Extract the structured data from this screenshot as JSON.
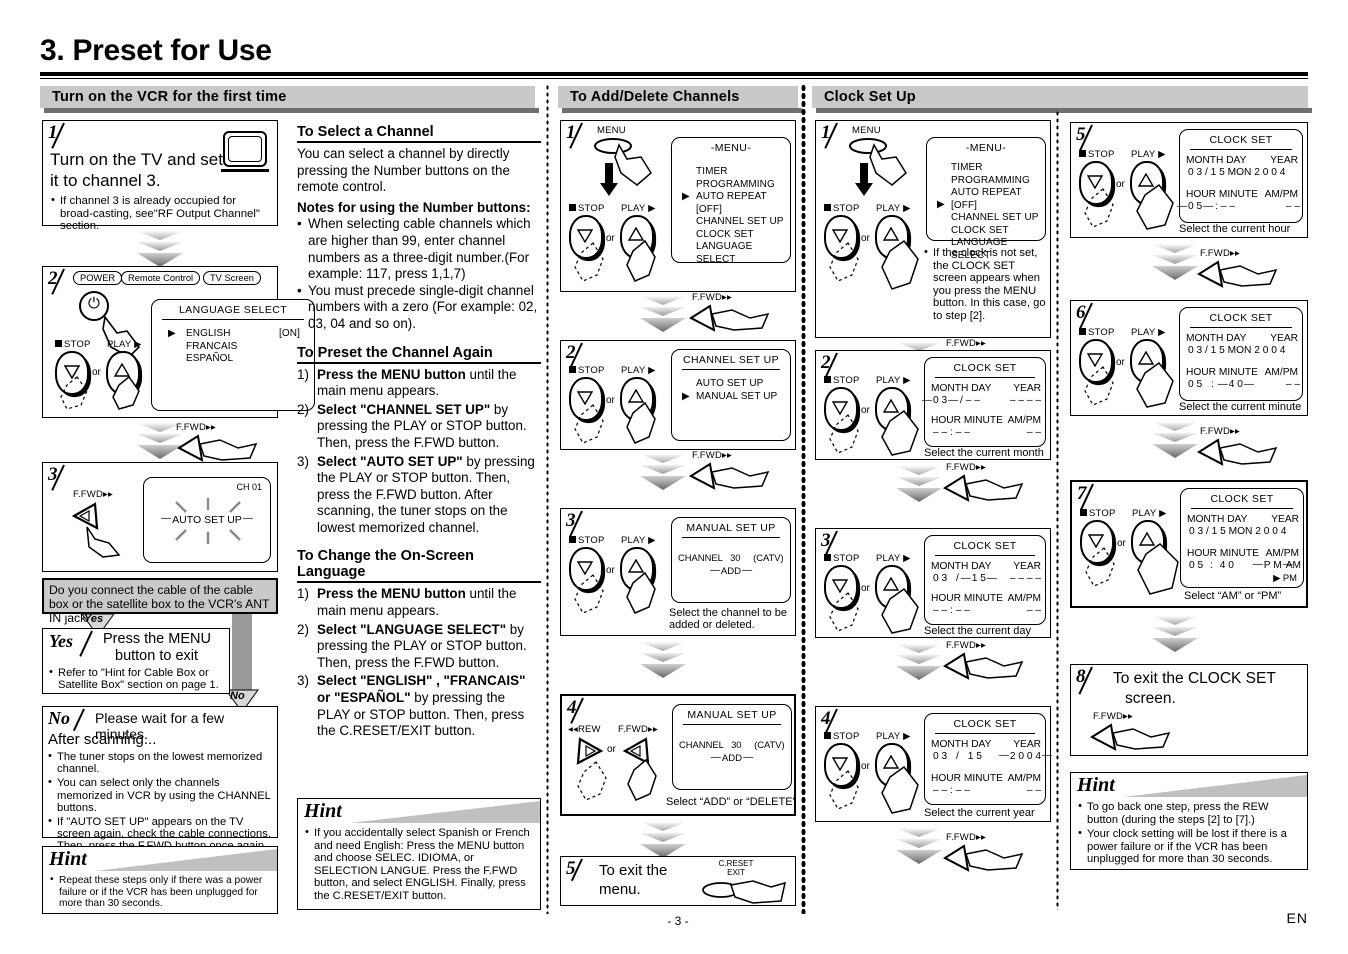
{
  "page": {
    "title": "3. Preset for Use",
    "footer_page": "- 3 -",
    "footer_lang": "EN"
  },
  "sections": {
    "col1_header": "Turn on the VCR for the first time",
    "col3_header": "To Add/Delete Channels",
    "col4_header": "Clock Set Up"
  },
  "col1": {
    "step1": {
      "num": "1",
      "line1": "Turn on the TV and set",
      "line2": "it to channel 3.",
      "note": "If channel 3 is already occupied for broad-casting, see\"RF Output Channel\" section."
    },
    "step2": {
      "num": "2",
      "power_label": "POWER",
      "bubble_remote": "Remote Control",
      "bubble_tv": "TV Screen",
      "stop_label": "STOP",
      "play_label": "PLAY",
      "or_label": "or",
      "osd_title": "LANGUAGE SELECT",
      "osd_items": [
        "ENGLISH",
        "FRANCAIS",
        "ESPAÑOL"
      ],
      "osd_on": "[ON]",
      "cursor": "▶"
    },
    "ffwd_label": "F.FWD",
    "step3": {
      "num": "3",
      "ffwd_label": "F.FWD",
      "ch_label": "CH 01",
      "osd_text": "AUTO SET UP"
    },
    "question": "Do you connect the cable of the cable box or the satellite box to the VCR's ANT IN jack?",
    "yes_tag": "Yes",
    "no_tag": "No",
    "yes_box": {
      "label": "Yes",
      "line1": "Press the MENU",
      "line2": "button to exit",
      "note": "Refer to \"Hint for Cable Box or Satellite Box\" section on page 1."
    },
    "no_box": {
      "label": "No",
      "lead": "Please wait for a few minutes.",
      "subhead": "After scanning...",
      "bullets": [
        "The tuner stops on the lowest memorized channel.",
        "You can select only the channels memorized in VCR by using the CHANNEL buttons.",
        "If \"AUTO SET UP\" appears on the TV screen again, check the cable connections. Then, press the F.FWD button once again."
      ]
    },
    "hint": {
      "title": "Hint",
      "bullets": [
        "Repeat these steps only if there was a power failure or if the VCR has been unplugged for more than 30 seconds."
      ]
    }
  },
  "col2": {
    "select_channel": {
      "heading": "To Select a Channel",
      "para": "You can select a channel by directly pressing the Number buttons on the remote control.",
      "notes_heading": "Notes for using the Number buttons:",
      "bullets": [
        "When selecting cable channels which are higher than 99, enter channel numbers as a three-digit number.(For example: 117, press 1,1,7)",
        "You must precede single-digit channel numbers with a zero (For example: 02, 03, 04 and so on)."
      ]
    },
    "preset_again": {
      "heading": "To Preset the Channel Again",
      "steps": [
        {
          "n": "1)",
          "bold": "Press the MENU button",
          "rest": " until the main menu appears."
        },
        {
          "n": "2)",
          "bold": "Select \"CHANNEL SET UP\"",
          "rest": " by pressing the PLAY or STOP button. Then, press the F.FWD button."
        },
        {
          "n": "3)",
          "bold": "Select \"AUTO SET UP\"",
          "rest": " by pressing  the PLAY or STOP button. Then, press the F.FWD button. After scanning, the tuner stops on the lowest memorized channel."
        }
      ]
    },
    "change_language": {
      "heading": "To Change the On-Screen Language",
      "steps": [
        {
          "n": "1)",
          "bold": "Press the MENU button",
          "rest": " until the main menu appears."
        },
        {
          "n": "2)",
          "bold": "Select \"LANGUAGE SELECT\"",
          "rest": " by pressing the PLAY or STOP button. Then, press the F.FWD button."
        },
        {
          "n": "3)",
          "bold": "Select \"ENGLISH\" , \"FRANCAIS\" or \"ESPAÑOL\"",
          "rest": " by pressing the PLAY or STOP button. Then, press the C.RESET/EXIT button."
        }
      ]
    },
    "hint": {
      "title": "Hint",
      "bullets": [
        "If you accidentally select Spanish or French and need English: Press the MENU button and choose SELEC. IDIOMA, or SELECTION LANGUE.  Press the F.FWD button, and select ENGLISH. Finally, press the C.RESET/EXIT button."
      ]
    }
  },
  "col3": {
    "step1": {
      "num": "1",
      "menu_label": "MENU",
      "stop_label": "STOP",
      "play_label": "PLAY",
      "or_label": "or",
      "osd_title": "-MENU-",
      "osd_items": [
        "TIMER PROGRAMMING",
        "AUTO REPEAT  [OFF]",
        "CHANNEL SET UP",
        "CLOCK SET",
        "LANGUAGE SELECT"
      ],
      "cursor_index": 2
    },
    "step2": {
      "num": "2",
      "stop_label": "STOP",
      "play_label": "PLAY",
      "or_label": "or",
      "osd_title": "CHANNEL SET UP",
      "osd_items": [
        "AUTO SET UP",
        "MANUAL SET UP"
      ],
      "cursor_index": 1
    },
    "step3": {
      "num": "3",
      "stop_label": "STOP",
      "play_label": "PLAY",
      "or_label": "or",
      "osd_title": "MANUAL SET UP",
      "channel_label": "CHANNEL",
      "channel_value": "30",
      "catv": "(CATV)",
      "addel": "ADD",
      "caption": "Select the channel to be added or deleted."
    },
    "step4": {
      "num": "4",
      "rew_label": "REW",
      "ffwd_label": "F.FWD",
      "or_label": "or",
      "osd_title": "MANUAL SET UP",
      "channel_label": "CHANNEL",
      "channel_value": "30",
      "catv": "(CATV)",
      "addel": "ADD",
      "caption": "Select “ADD” or “DELETE”"
    },
    "step5": {
      "num": "5",
      "line1": "To exit the",
      "line2": "menu.",
      "btn_label1": "C.RESET",
      "btn_label2": "EXIT"
    },
    "ffwd_label": "F.FWD"
  },
  "col4": {
    "step1": {
      "num": "1",
      "menu_label": "MENU",
      "stop_label": "STOP",
      "play_label": "PLAY",
      "or_label": "or",
      "osd_title": "-MENU-",
      "osd_items": [
        "TIMER PROGRAMMING",
        "AUTO REPEAT  [OFF]",
        "CHANNEL SET UP",
        "CLOCK SET",
        "LANGUAGE SELECT"
      ],
      "cursor_index": 3,
      "note": "If the clock is not set, the CLOCK SET screen appears when you press the MENU button. In this case, go to step [2]."
    },
    "step2": {
      "num": "2",
      "stop_label": "STOP",
      "play_label": "PLAY",
      "or_label": "or",
      "osd_title": "CLOCK SET",
      "h_month": "MONTH",
      "h_day": "DAY",
      "h_year": "YEAR",
      "v_month": "0 3",
      "v_sep": "/",
      "v_day": "– –",
      "v_year": "– – – –",
      "h_hour": "HOUR",
      "h_minute": "MINUTE",
      "h_ampm": "AM/PM",
      "v_hour": "– –",
      "v_colon": ":",
      "v_minute": "– –",
      "v_ampm": "– –",
      "caption": "Select the current month"
    },
    "step3": {
      "num": "3",
      "stop_label": "STOP",
      "play_label": "PLAY",
      "or_label": "or",
      "osd_title": "CLOCK SET",
      "h_month": "MONTH",
      "h_day": "DAY",
      "h_year": "YEAR",
      "v_month": "0 3",
      "v_sep": "/",
      "v_day": "1 5",
      "v_year": "– – – –",
      "h_hour": "HOUR",
      "h_minute": "MINUTE",
      "h_ampm": "AM/PM",
      "v_hour": "– –",
      "v_colon": ":",
      "v_minute": "– –",
      "v_ampm": "– –",
      "caption": "Select the current day"
    },
    "step4": {
      "num": "4",
      "stop_label": "STOP",
      "play_label": "PLAY",
      "or_label": "or",
      "osd_title": "CLOCK SET",
      "h_month": "MONTH",
      "h_day": "DAY",
      "h_year": "YEAR",
      "v_month": "0 3",
      "v_sep": "/",
      "v_day": "1 5",
      "v_year": "2 0 0 4",
      "h_hour": "HOUR",
      "h_minute": "MINUTE",
      "h_ampm": "AM/PM",
      "v_hour": "– –",
      "v_colon": ":",
      "v_minute": "– –",
      "v_ampm": "– –",
      "caption": "Select the current year"
    },
    "ffwd_label": "F.FWD"
  },
  "col5": {
    "step5": {
      "num": "5",
      "stop_label": "STOP",
      "play_label": "PLAY",
      "or_label": "or",
      "osd_title": "CLOCK SET",
      "h_month": "MONTH",
      "h_day": "DAY",
      "h_year": "YEAR",
      "v_date": "0 3  /  1 5  MON 2 0 0 4",
      "h_hour": "HOUR",
      "h_minute": "MINUTE",
      "h_ampm": "AM/PM",
      "v_hour": "0 5",
      "v_colon": ":",
      "v_minute": "– –",
      "v_ampm": "– –",
      "caption": "Select the current hour"
    },
    "step6": {
      "num": "6",
      "stop_label": "STOP",
      "play_label": "PLAY",
      "or_label": "or",
      "osd_title": "CLOCK SET",
      "h_month": "MONTH",
      "h_day": "DAY",
      "h_year": "YEAR",
      "v_date": "0 3  /  1 5  MON 2 0 0 4",
      "h_hour": "HOUR",
      "h_minute": "MINUTE",
      "h_ampm": "AM/PM",
      "v_hour": "0 5",
      "v_colon": ":",
      "v_minute": "4 0",
      "v_ampm": "– –",
      "caption": "Select the current minute"
    },
    "step7": {
      "num": "7",
      "stop_label": "STOP",
      "play_label": "PLAY",
      "or_label": "or",
      "osd_title": "CLOCK SET",
      "h_month": "MONTH",
      "h_day": "DAY",
      "h_year": "YEAR",
      "v_date": "0 3  /  1 5  MON 2 0 0 4",
      "h_hour": "HOUR",
      "h_minute": "MINUTE",
      "h_ampm": "AM/PM",
      "v_hour": "0 5",
      "v_colon": ":",
      "v_minute": "4 0",
      "v_ampm_blink": "P M",
      "v_ampm_alt": "AM",
      "v_ampm_sel": "▶ PM",
      "caption": "Select “AM” or “PM”"
    },
    "step8": {
      "num": "8",
      "line1": "To exit the CLOCK SET",
      "line2": "screen.",
      "ffwd_label": "F.FWD"
    },
    "hint": {
      "title": "Hint",
      "bullets": [
        "To go back one step, press the REW button (during the steps [2] to [7].)",
        "Your clock setting will be lost if there is a power failure or if the VCR has been unplugged for more than 30 seconds."
      ]
    },
    "ffwd_label": "F.FWD"
  }
}
